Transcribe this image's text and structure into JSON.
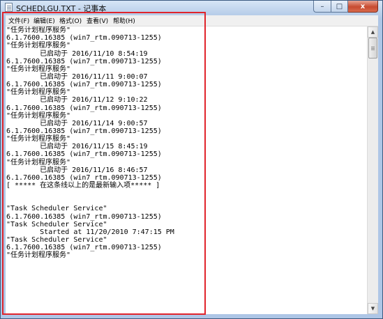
{
  "window": {
    "title": "SCHEDLGU.TXT - 记事本",
    "controls": {
      "minimize": "–",
      "maximize": "□",
      "close": "x"
    }
  },
  "menu": [
    {
      "label": "文件(F)"
    },
    {
      "label": "编辑(E)"
    },
    {
      "label": "格式(O)"
    },
    {
      "label": "查看(V)"
    },
    {
      "label": "帮助(H)"
    }
  ],
  "scrollbar": {
    "up": "▲",
    "down": "▼"
  },
  "lines": [
    "\"任务计划程序服务\"",
    "6.1.7600.16385 (win7_rtm.090713-1255)",
    "\"任务计划程序服务\"",
    "        已启动于 2016/11/10 8:54:19",
    "6.1.7600.16385 (win7_rtm.090713-1255)",
    "\"任务计划程序服务\"",
    "        已启动于 2016/11/11 9:00:07",
    "6.1.7600.16385 (win7_rtm.090713-1255)",
    "\"任务计划程序服务\"",
    "        已启动于 2016/11/12 9:10:22",
    "6.1.7600.16385 (win7_rtm.090713-1255)",
    "\"任务计划程序服务\"",
    "        已启动于 2016/11/14 9:00:57",
    "6.1.7600.16385 (win7_rtm.090713-1255)",
    "\"任务计划程序服务\"",
    "        已启动于 2016/11/15 8:45:19",
    "6.1.7600.16385 (win7_rtm.090713-1255)",
    "\"任务计划程序服务\"",
    "        已启动于 2016/11/16 8:46:57",
    "6.1.7600.16385 (win7_rtm.090713-1255)",
    "[ ***** 在这条线以上的是最新输入项***** ]",
    "",
    "",
    "\"Task Scheduler Service\"",
    "6.1.7600.16385 (win7_rtm.090713-1255)",
    "\"Task Scheduler Service\"",
    "        Started at 11/20/2010 7:47:15 PM",
    "\"Task Scheduler Service\"",
    "6.1.7600.16385 (win7_rtm.090713-1255)",
    "\"任务计划程序服务\""
  ]
}
